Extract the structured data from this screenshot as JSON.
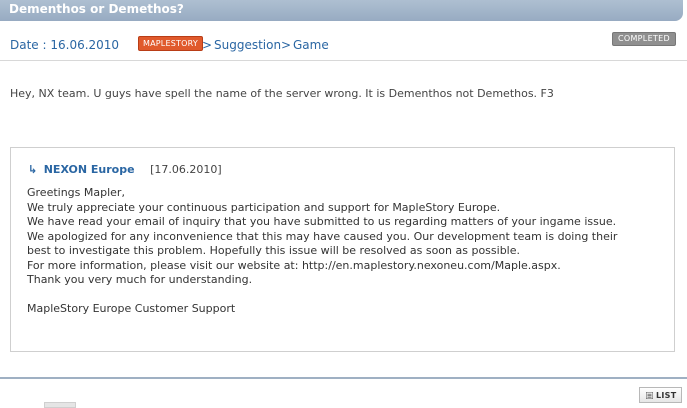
{
  "title": "Dementhos or Demethos?",
  "meta": {
    "date": "Date : 16.06.2010",
    "category_badge": "MAPLESTORY",
    "breadcrumb_sep": ">",
    "breadcrumb": [
      "Suggestion",
      "Game"
    ],
    "status": "COMPLETED"
  },
  "question": "Hey, NX team. U guys have spell the name of the server wrong. It is Dementhos not Demethos. F3",
  "reply": {
    "arrow_icon": "reply-arrow-icon",
    "author": "NEXON Europe",
    "date": "[17.06.2010]",
    "lines": [
      "Greetings Mapler,",
      "We truly appreciate your continuous participation and support for MapleStory Europe.",
      "We have read your email of inquiry that you have submitted to us regarding matters of your ingame issue.",
      "We apologized for any inconvenience that this may have caused you. Our development team is doing their",
      "best to investigate this problem. Hopefully this issue will be resolved as soon as possible.",
      "For more information, please visit our website at: http://en.maplestory.nexoneu.com/Maple.aspx.",
      "Thank you very much for  understanding.",
      "",
      "MapleStory Europe Customer Support"
    ]
  },
  "footer": {
    "list_label": "LIST"
  },
  "colors": {
    "title_bar": "#a6b8cc",
    "link_blue": "#2a66a3",
    "badge_orange": "#e05a2c",
    "badge_grey": "#8f8f8f"
  }
}
